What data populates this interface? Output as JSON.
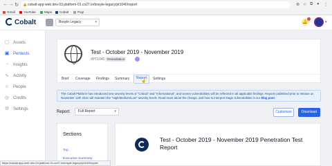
{
  "browser": {
    "url": "cobalt-app-web.dev-03.platform-01.co27.io/bosyle-legacy/pt1040/report",
    "bookmarks": [
      "Gmail",
      "YouTube",
      "Maps",
      "Cobalt",
      "Pog!"
    ],
    "bookmark_colors": [
      "#ea4335",
      "#ff0000",
      "#34a853",
      "#1e3a8a",
      "#9ca3af"
    ]
  },
  "header": {
    "logo": "Cobalt",
    "org_select": "Bosyle Legacy",
    "accent": "#2563eb"
  },
  "sidebar": {
    "items": [
      {
        "label": "Assets",
        "icon": "cube-icon",
        "glyph": "▢",
        "active": false
      },
      {
        "label": "Pentests",
        "icon": "pentest-icon",
        "glyph": "▣",
        "active": true
      },
      {
        "label": "Insights",
        "icon": "insights-icon",
        "glyph": "◔",
        "active": false
      },
      {
        "label": "Activity",
        "icon": "activity-icon",
        "glyph": "∿",
        "active": false
      },
      {
        "label": "People",
        "icon": "people-icon",
        "glyph": "☺",
        "active": false
      },
      {
        "label": "Credits",
        "icon": "credits-icon",
        "glyph": "◎",
        "active": false
      },
      {
        "label": "Settings",
        "icon": "gear-icon",
        "glyph": "⚙",
        "active": false
      }
    ]
  },
  "pentest": {
    "title": "Test - October 2019 - November 2019",
    "id": "#PT1040",
    "tag": "Remediation",
    "tabs": [
      "Brief",
      "Coverage",
      "Findings",
      "Summary",
      "Report",
      "Settings"
    ],
    "active_tab": "Report"
  },
  "banner": {
    "text": "The Cobalt Platform has introduced new severity levels of \"Critical\" and \"Informational\", and severe vulnerabilities will be reflected in all applicable findings. Reports published prior to release on November 12th 2021 will maintain the \"High/Medium/Low\" severity levels. Read more about the change, and how to interpret triage vulnerabilities in our",
    "link": "blog post"
  },
  "report": {
    "label": "Report:",
    "select_value": "Full Report",
    "customize": "Customize",
    "download": "Download"
  },
  "sections": {
    "title": "Sections",
    "links": [
      "Top",
      "Executive Summary"
    ]
  },
  "preview": {
    "title": "Test - October 2019 - November 2019 Penetration Test Report"
  },
  "statusbar": {
    "text": "https://cobalt-app-web.dev-03.platform-01.co27.io/bosyle-legacy/pt1040/report"
  }
}
